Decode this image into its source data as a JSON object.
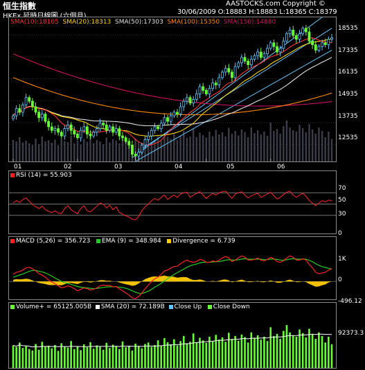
{
  "title": "恒生指數",
  "subtitle": "HKEx 延時日線圖 (六個月)",
  "copyright": "AASTOCKS.com Copyright ©",
  "ohlc": "30/06/2009  O:18883 H:18883 L:18365 C:18379",
  "price_legend": {
    "sma10": "SMA(10):18105",
    "sma20": "SMA(20):18313",
    "sma50": "SMA(50):17303",
    "sma100": "SMA(100):15350",
    "sma150": "SMA(150):14880"
  },
  "rsi_legend": "RSI (14) = 55.903",
  "macd_legend": {
    "macd": "MACD (5,26) = 356.723",
    "ema": "EMA (9) = 348.984",
    "divergence": "Divergence = 6.739"
  },
  "volume_legend": {
    "volume": "Volume+ = 65125.005B",
    "sma": "SMA (20) = 72.189B",
    "close_up": "Close Up",
    "close_down": "Close Down"
  },
  "colors": {
    "sma10": "#ff3030",
    "sma20": "#ffd700",
    "sma50": "#e0e0e0",
    "sma100": "#ff8800",
    "sma150": "#d01060",
    "up": "#5ec8ff",
    "down": "#66ff33",
    "channel": "#5ec8ff",
    "rsi": "#ff2020",
    "macd": "#ff2020",
    "ema": "#22cc22",
    "divergence": "#ffcc00",
    "volume": "#66ff33",
    "volume_sma": "#ffffff"
  },
  "chart_data": [
    {
      "type": "candlestick",
      "x_ticks": [
        "01",
        "02",
        "03",
        "04",
        "05",
        "06"
      ],
      "y_ticks": [
        "18535",
        "17335",
        "16135",
        "14935",
        "13735",
        "12535"
      ],
      "ylim": [
        11600,
        19500
      ],
      "closes": [
        14100,
        14500,
        14300,
        14700,
        15100,
        14900,
        14600,
        14300,
        14000,
        14200,
        13800,
        13500,
        13300,
        13400,
        13200,
        13000,
        13400,
        13600,
        13300,
        13100,
        12900,
        13300,
        13500,
        13100,
        13000,
        13200,
        13400,
        13700,
        13600,
        13300,
        13500,
        13200,
        13400,
        13000,
        12900,
        12700,
        12500,
        12000,
        11900,
        12100,
        12500,
        12800,
        13000,
        13300,
        13500,
        13400,
        13700,
        14000,
        13800,
        14100,
        14300,
        14200,
        14600,
        14900,
        15100,
        14800,
        15000,
        15300,
        15700,
        15500,
        15300,
        15600,
        15900,
        15800,
        16200,
        16500,
        16700,
        16500,
        16200,
        16800,
        17000,
        17300,
        17100,
        16900,
        17200,
        17400,
        17600,
        17300,
        17500,
        17800,
        18100,
        17900,
        17600,
        17800,
        18200,
        18600,
        18800,
        18500,
        18300,
        18600,
        18900,
        18700,
        18200,
        18000,
        17700,
        17900,
        18100,
        18000,
        18300,
        18379
      ],
      "sma10_end": 18105,
      "sma20_end": 18313,
      "sma50_end": 17303,
      "sma100_end": 15350,
      "sma150_end": 14880
    },
    {
      "type": "line",
      "name": "RSI (14)",
      "y_ticks": [
        "70",
        "50",
        "30",
        "0"
      ],
      "ylim": [
        0,
        100
      ],
      "values": [
        52,
        56,
        53,
        58,
        61,
        55,
        49,
        45,
        42,
        46,
        40,
        37,
        35,
        38,
        34,
        33,
        42,
        47,
        40,
        36,
        33,
        42,
        47,
        38,
        36,
        41,
        46,
        52,
        50,
        43,
        48,
        40,
        45,
        35,
        32,
        29,
        27,
        23,
        22,
        28,
        38,
        45,
        50,
        56,
        60,
        57,
        62,
        66,
        58,
        63,
        66,
        62,
        68,
        70,
        71,
        62,
        66,
        69,
        72,
        66,
        60,
        65,
        69,
        66,
        70,
        72,
        73,
        66,
        60,
        68,
        70,
        72,
        66,
        61,
        65,
        67,
        69,
        62,
        65,
        68,
        71,
        65,
        59,
        62,
        67,
        71,
        73,
        66,
        62,
        66,
        69,
        64,
        56,
        52,
        47,
        52,
        56,
        54,
        57,
        55.903
      ]
    },
    {
      "type": "line",
      "name": "MACD",
      "y_ticks": [
        "1K",
        "0",
        "-496.12"
      ],
      "ylim": [
        -500,
        1250
      ],
      "macd": [
        200,
        260,
        280,
        320,
        380,
        400,
        360,
        300,
        220,
        180,
        120,
        40,
        -20,
        -60,
        -120,
        -180,
        -160,
        -120,
        -150,
        -200,
        -260,
        -220,
        -180,
        -200,
        -240,
        -220,
        -180,
        -120,
        -100,
        -120,
        -110,
        -150,
        -140,
        -200,
        -260,
        -320,
        -380,
        -460,
        -480,
        -420,
        -320,
        -200,
        -100,
        0,
        80,
        120,
        200,
        300,
        320,
        380,
        420,
        430,
        500,
        560,
        600,
        560,
        540,
        560,
        620,
        600,
        540,
        540,
        580,
        560,
        600,
        660,
        700,
        660,
        560,
        600,
        660,
        720,
        680,
        600,
        600,
        620,
        660,
        600,
        580,
        620,
        680,
        640,
        560,
        540,
        580,
        660,
        720,
        680,
        600,
        600,
        640,
        600,
        480,
        380,
        260,
        220,
        240,
        260,
        320,
        356.723
      ],
      "ema": [
        120,
        150,
        180,
        210,
        250,
        290,
        310,
        310,
        290,
        270,
        240,
        200,
        150,
        100,
        50,
        0,
        -30,
        -50,
        -80,
        -110,
        -140,
        -160,
        -170,
        -180,
        -190,
        -200,
        -195,
        -180,
        -165,
        -155,
        -148,
        -148,
        -146,
        -155,
        -170,
        -190,
        -220,
        -260,
        -300,
        -330,
        -335,
        -310,
        -270,
        -220,
        -160,
        -110,
        -50,
        20,
        80,
        140,
        200,
        250,
        300,
        350,
        400,
        440,
        470,
        490,
        520,
        540,
        540,
        540,
        550,
        555,
        560,
        580,
        600,
        610,
        600,
        600,
        610,
        630,
        640,
        630,
        625,
        625,
        630,
        625,
        615,
        615,
        630,
        632,
        620,
        600,
        595,
        610,
        630,
        640,
        630,
        625,
        630,
        625,
        595,
        555,
        500,
        450,
        420,
        395,
        370,
        348.984
      ],
      "divergence": [
        80,
        110,
        100,
        110,
        130,
        110,
        50,
        -10,
        -70,
        -90,
        -120,
        -160,
        -170,
        -160,
        -170,
        -180,
        -130,
        -70,
        -70,
        -90,
        -120,
        -60,
        -10,
        -20,
        -50,
        -20,
        15,
        60,
        65,
        35,
        38,
        -2,
        6,
        -45,
        -90,
        -130,
        -160,
        -200,
        -180,
        -90,
        15,
        110,
        170,
        220,
        240,
        230,
        250,
        280,
        240,
        240,
        220,
        180,
        200,
        210,
        200,
        120,
        70,
        70,
        100,
        60,
        0,
        0,
        30,
        5,
        40,
        80,
        100,
        50,
        -40,
        0,
        50,
        90,
        40,
        -30,
        -25,
        -5,
        30,
        -25,
        -35,
        5,
        50,
        8,
        -60,
        -60,
        -15,
        50,
        90,
        40,
        -30,
        -25,
        10,
        -25,
        -115,
        -175,
        -240,
        -230,
        -180,
        -135,
        -50,
        6.739
      ]
    },
    {
      "type": "bar",
      "name": "Volume",
      "y_ticks": [
        "92373.3"
      ],
      "ylim": [
        0,
        140000
      ],
      "values": [
        62000,
        58000,
        70000,
        55000,
        60000,
        52000,
        48000,
        66000,
        50000,
        72000,
        58000,
        61000,
        54000,
        63000,
        47000,
        68000,
        59000,
        56000,
        74000,
        52000,
        60000,
        49000,
        65000,
        57000,
        71000,
        53000,
        62000,
        58000,
        50000,
        69000,
        55000,
        64000,
        60000,
        52000,
        73000,
        57000,
        61000,
        48000,
        67000,
        59000,
        54000,
        66000,
        70000,
        58000,
        63000,
        76000,
        60000,
        82000,
        71000,
        65000,
        79000,
        62000,
        74000,
        88000,
        68000,
        72000,
        95000,
        70000,
        83000,
        76000,
        69000,
        86000,
        73000,
        91000,
        78000,
        84000,
        72000,
        97000,
        80000,
        88000,
        75000,
        92000,
        85000,
        70000,
        98000,
        82000,
        90000,
        78000,
        86000,
        74000,
        112000,
        88000,
        94000,
        80000,
        102000,
        118000,
        98000,
        90000,
        86000,
        106000,
        96000,
        84000,
        108000,
        92000,
        80000,
        98000,
        88000,
        70000,
        86000,
        65125
      ]
    }
  ]
}
